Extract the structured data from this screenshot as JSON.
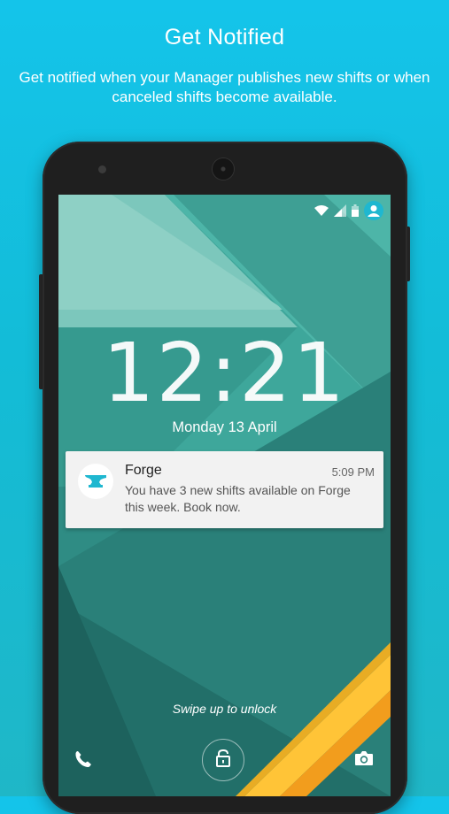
{
  "promo": {
    "title": "Get Notified",
    "subtitle": "Get notified when your Manager publishes new shifts or when canceled shifts become available."
  },
  "lockscreen": {
    "time": "12:21",
    "date": "Monday 13 April",
    "swipe_hint": "Swipe up to unlock"
  },
  "status_bar": {
    "icons": [
      "wifi-icon",
      "signal-icon",
      "battery-icon",
      "user-avatar-icon"
    ]
  },
  "notification": {
    "app_name": "Forge",
    "time": "5:09 PM",
    "message": "You have 3 new shifts available on Forge this week. Book now.",
    "icon": "anvil-icon"
  },
  "bottom_icons": [
    "phone-icon",
    "unlock-icon",
    "camera-icon"
  ],
  "colors": {
    "background": "#14c4ea",
    "wallpaper": "#2f8f86",
    "accent": "#1fb7d0",
    "stripe": "#f5b82a"
  }
}
